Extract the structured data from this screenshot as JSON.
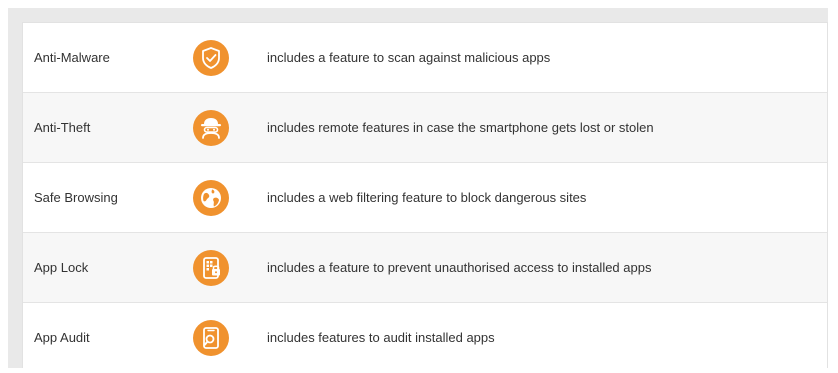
{
  "colors": {
    "accent": "#f0922e",
    "text": "#333333",
    "row_alt": "#f7f7f7",
    "frame": "#e9e9e9"
  },
  "features": [
    {
      "name": "Anti-Malware",
      "icon": "shield-check-icon",
      "description": "includes a feature to scan against malicious apps"
    },
    {
      "name": "Anti-Theft",
      "icon": "thief-icon",
      "description": "includes remote features in case the smartphone gets lost or stolen"
    },
    {
      "name": "Safe Browsing",
      "icon": "globe-icon",
      "description": "includes a web filtering feature to block dangerous sites"
    },
    {
      "name": "App Lock",
      "icon": "app-lock-icon",
      "description": "includes a feature to prevent unauthorised access to installed apps"
    },
    {
      "name": "App Audit",
      "icon": "app-audit-icon",
      "description": "includes features to audit installed apps"
    }
  ]
}
